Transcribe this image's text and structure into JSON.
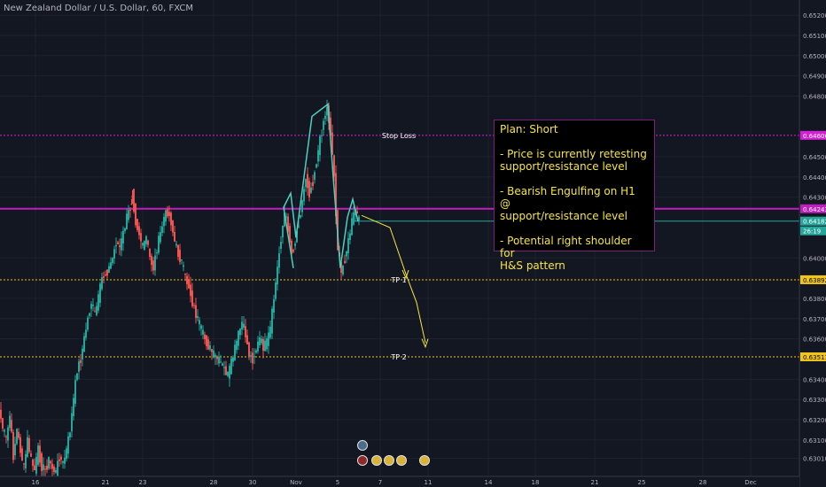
{
  "symbol": "New Zealand Dollar / U.S. Dollar, 60, FXCM",
  "plan_lines": [
    "Plan: Short",
    "",
    "- Price is currently retesting",
    "support/resistance level",
    "",
    "- Bearish Engulfing on H1 @",
    "support/resistance level",
    "",
    "- Potential right shoulder for",
    "H&S pattern"
  ],
  "colors": {
    "background": "#131722",
    "bull": "#26a69a",
    "bear": "#ef5350",
    "stop_line": "#d41fd4",
    "resistance_line": "#c01fc0",
    "tp_line": "#f0c419",
    "pattern": "#4dd0c0",
    "projection": "#f5e642",
    "current_line": "#26a69a"
  },
  "icons": {
    "events": [
      "calendar-event-icon",
      "flag-event-icon",
      "emoji-event-icon"
    ]
  },
  "chart_data": {
    "type": "candlestick",
    "symbol": "NZDUSD",
    "timeframe": "60",
    "xlabel": "",
    "ylabel": "",
    "ylim": [
      0.6292,
      0.6524
    ],
    "x_ticks": [
      "16",
      "21",
      "23",
      "28",
      "30",
      "Nov",
      "5",
      "7",
      "11",
      "14",
      "18",
      "21",
      "25",
      "28",
      "Dec"
    ],
    "y_ticks": [
      "0.63010",
      "0.63100",
      "0.63200",
      "0.63300",
      "0.63400",
      "0.63600",
      "0.63700",
      "0.63800",
      "0.64000",
      "0.64300",
      "0.64400",
      "0.64500",
      "0.64800",
      "0.64900",
      "0.65000",
      "0.65100",
      "0.65200"
    ],
    "price_labels": [
      {
        "name": "stop",
        "value": "0.64606"
      },
      {
        "name": "resistance",
        "value": "0.64243"
      },
      {
        "name": "current",
        "value": "0.64182"
      },
      {
        "name": "countdown",
        "value": "26:19"
      },
      {
        "name": "tp1",
        "value": "0.63892"
      },
      {
        "name": "tp2",
        "value": "0.63511"
      }
    ],
    "levels": [
      {
        "name": "Stop Loss",
        "value": 0.64606
      },
      {
        "name": "",
        "value": 0.64243
      },
      {
        "name": "TP 1",
        "value": 0.63892
      },
      {
        "name": "TP 2",
        "value": 0.63511
      }
    ],
    "current_price": 0.64182,
    "close_path": [
      [
        0,
        0.6325
      ],
      [
        4,
        0.6316
      ],
      [
        8,
        0.631
      ],
      [
        12,
        0.6322
      ],
      [
        16,
        0.6302
      ],
      [
        20,
        0.6315
      ],
      [
        24,
        0.6305
      ],
      [
        28,
        0.6296
      ],
      [
        32,
        0.631
      ],
      [
        36,
        0.63
      ],
      [
        40,
        0.6295
      ],
      [
        44,
        0.6305
      ],
      [
        48,
        0.6297
      ],
      [
        52,
        0.6295
      ],
      [
        56,
        0.63
      ],
      [
        60,
        0.6296
      ],
      [
        64,
        0.6294
      ],
      [
        68,
        0.6302
      ],
      [
        72,
        0.6298
      ],
      [
        76,
        0.6305
      ],
      [
        80,
        0.6315
      ],
      [
        84,
        0.633
      ],
      [
        88,
        0.6345
      ],
      [
        92,
        0.635
      ],
      [
        96,
        0.636
      ],
      [
        100,
        0.637
      ],
      [
        104,
        0.6378
      ],
      [
        108,
        0.6372
      ],
      [
        112,
        0.638
      ],
      [
        116,
        0.639
      ],
      [
        120,
        0.6392
      ],
      [
        124,
        0.6395
      ],
      [
        128,
        0.64
      ],
      [
        132,
        0.6408
      ],
      [
        136,
        0.6405
      ],
      [
        140,
        0.6412
      ],
      [
        144,
        0.642
      ],
      [
        148,
        0.6425
      ],
      [
        150,
        0.6432
      ],
      [
        154,
        0.6418
      ],
      [
        158,
        0.6412
      ],
      [
        162,
        0.6405
      ],
      [
        166,
        0.641
      ],
      [
        170,
        0.64
      ],
      [
        174,
        0.6395
      ],
      [
        178,
        0.6405
      ],
      [
        182,
        0.6412
      ],
      [
        186,
        0.642
      ],
      [
        190,
        0.6423
      ],
      [
        194,
        0.6418
      ],
      [
        198,
        0.6408
      ],
      [
        202,
        0.6402
      ],
      [
        206,
        0.6398
      ],
      [
        210,
        0.639
      ],
      [
        214,
        0.6386
      ],
      [
        218,
        0.6378
      ],
      [
        222,
        0.6372
      ],
      [
        226,
        0.6367
      ],
      [
        230,
        0.6362
      ],
      [
        234,
        0.6358
      ],
      [
        238,
        0.6355
      ],
      [
        242,
        0.6352
      ],
      [
        246,
        0.635
      ],
      [
        250,
        0.6348
      ],
      [
        254,
        0.6345
      ],
      [
        258,
        0.6342
      ],
      [
        262,
        0.6348
      ],
      [
        266,
        0.6355
      ],
      [
        270,
        0.6362
      ],
      [
        274,
        0.6368
      ],
      [
        278,
        0.6362
      ],
      [
        282,
        0.6352
      ],
      [
        286,
        0.635
      ],
      [
        290,
        0.6355
      ],
      [
        294,
        0.636
      ],
      [
        298,
        0.6356
      ],
      [
        302,
        0.6358
      ],
      [
        306,
        0.6365
      ],
      [
        310,
        0.638
      ],
      [
        314,
        0.6395
      ],
      [
        318,
        0.641
      ],
      [
        322,
        0.6422
      ],
      [
        326,
        0.6415
      ],
      [
        330,
        0.6402
      ],
      [
        334,
        0.6408
      ],
      [
        338,
        0.6418
      ],
      [
        342,
        0.6428
      ],
      [
        346,
        0.644
      ],
      [
        350,
        0.6432
      ],
      [
        354,
        0.6438
      ],
      [
        358,
        0.6448
      ],
      [
        362,
        0.6458
      ],
      [
        366,
        0.6468
      ],
      [
        370,
        0.6474
      ],
      [
        374,
        0.6462
      ],
      [
        378,
        0.644
      ],
      [
        382,
        0.6405
      ],
      [
        386,
        0.6392
      ],
      [
        390,
        0.64
      ],
      [
        394,
        0.6408
      ],
      [
        398,
        0.6418
      ],
      [
        402,
        0.6424
      ],
      [
        406,
        0.6418
      ]
    ],
    "annotations": [
      "Stop Loss",
      "TP 1",
      "TP 2"
    ]
  }
}
